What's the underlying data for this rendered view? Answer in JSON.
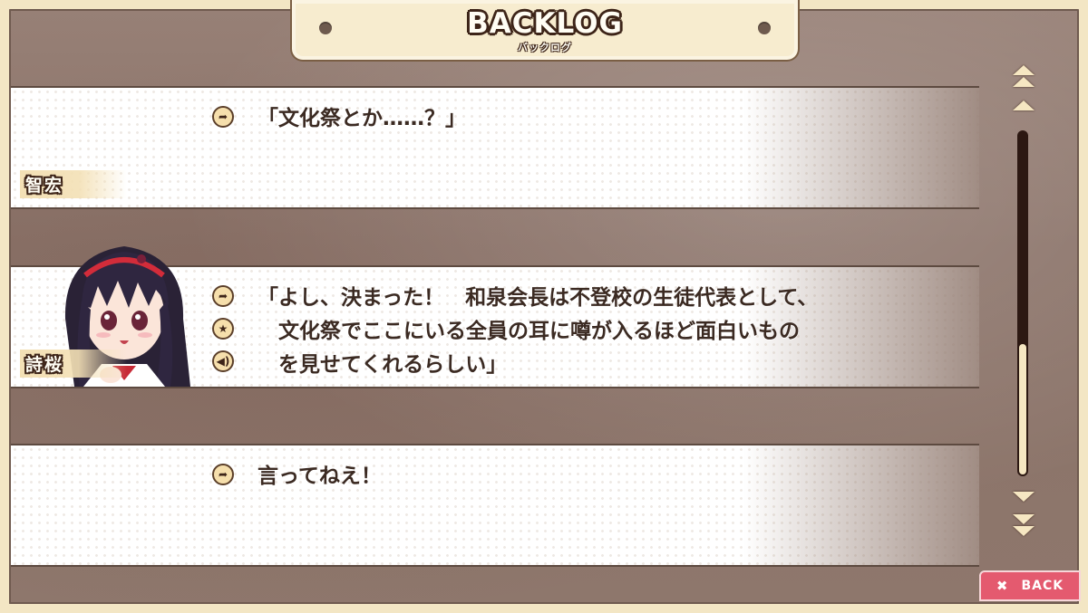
{
  "header": {
    "title": "BACKLOG",
    "subtitle": "バックログ"
  },
  "entries": [
    {
      "speaker": "智宏",
      "has_portrait": false,
      "lines": [
        "「文化祭とか……？」"
      ],
      "icons": [
        "replay-jump-icon"
      ]
    },
    {
      "speaker": "詩桜",
      "has_portrait": true,
      "lines": [
        "「よし、決まった！　和泉会長は不登校の生徒代表として、",
        "　文化祭でここにいる全員の耳に噂が入るほど面白いもの",
        "　を見せてくれるらしい」"
      ],
      "icons": [
        "replay-jump-icon",
        "star-icon",
        "voice-replay-icon"
      ]
    },
    {
      "speaker": "",
      "has_portrait": false,
      "lines": [
        "言ってねえ！"
      ],
      "icons": [
        "replay-jump-icon"
      ]
    }
  ],
  "scrollbar": {
    "position_fraction": 1.0,
    "visible_fraction": 0.38
  },
  "back_button": {
    "label": "BACK",
    "icon": "close-icon"
  },
  "colors": {
    "frame": "#f3e6c4",
    "back": "#e45a6f",
    "text": "#3b2a22",
    "outline": "#3d2418"
  }
}
